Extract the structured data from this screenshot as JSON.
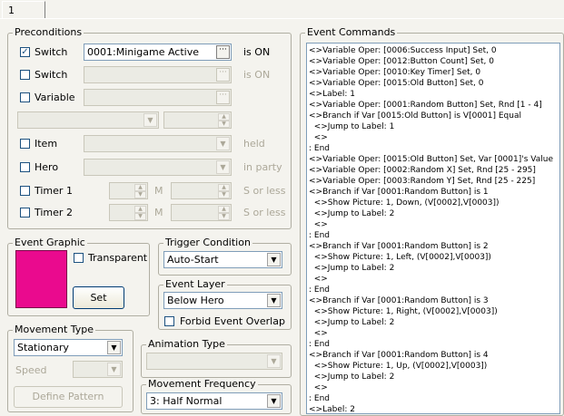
{
  "tab": {
    "label": "1"
  },
  "preconditions": {
    "title": "Preconditions",
    "switch1": {
      "label": "Switch",
      "checked": true,
      "value": "0001:Minigame Active",
      "suffix": "is ON"
    },
    "switch2": {
      "label": "Switch",
      "checked": false,
      "value": "",
      "suffix": "is ON"
    },
    "variable": {
      "label": "Variable",
      "checked": false,
      "value": ""
    },
    "item": {
      "label": "Item",
      "suffix": "held"
    },
    "hero": {
      "label": "Hero",
      "suffix": "in party"
    },
    "timer1": {
      "label": "Timer 1",
      "unit_m": "M",
      "unit_s": "S or less"
    },
    "timer2": {
      "label": "Timer 2",
      "unit_m": "M",
      "unit_s": "S or less"
    }
  },
  "event_graphic": {
    "title": "Event Graphic",
    "transparent_label": "Transparent",
    "set_label": "Set",
    "color": "#ea0a8e"
  },
  "trigger_condition": {
    "title": "Trigger Condition",
    "value": "Auto-Start"
  },
  "event_layer": {
    "title": "Event Layer",
    "value": "Below Hero",
    "forbid_label": "Forbid Event Overlap"
  },
  "movement_type": {
    "title": "Movement Type",
    "value": "Stationary",
    "speed_label": "Speed",
    "define_pattern_label": "Define Pattern"
  },
  "animation_type": {
    "title": "Animation Type",
    "value": ""
  },
  "movement_frequency": {
    "title": "Movement Frequency",
    "value": "3: Half Normal"
  },
  "event_commands": {
    "title": "Event Commands",
    "lines": [
      "<>Variable Oper: [0006:Success Input] Set, 0",
      "<>Variable Oper: [0012:Button Count] Set, 0",
      "<>Variable Oper: [0010:Key Timer] Set, 0",
      "<>Variable Oper: [0015:Old Button] Set, 0",
      "<>Label: 1",
      "<>Variable Oper: [0001:Random Button] Set, Rnd [1 - 4]",
      "<>Branch if Var [0015:Old Button] is V[0001] Equal",
      "  <>Jump to Label: 1",
      "  <>",
      ": End",
      "<>Variable Oper: [0015:Old Button] Set, Var [0001]'s Value",
      "<>Variable Oper: [0002:Random X] Set, Rnd [25 - 295]",
      "<>Variable Oper: [0003:Random Y] Set, Rnd [25 - 225]",
      "<>Branch if Var [0001:Random Button] is 1",
      "  <>Show Picture: 1, Down, (V[0002],V[0003])",
      "  <>Jump to Label: 2",
      "  <>",
      ": End",
      "<>Branch if Var [0001:Random Button] is 2",
      "  <>Show Picture: 1, Left, (V[0002],V[0003])",
      "  <>Jump to Label: 2",
      "  <>",
      ": End",
      "<>Branch if Var [0001:Random Button] is 3",
      "  <>Show Picture: 1, Right, (V[0002],V[0003])",
      "  <>Jump to Label: 2",
      "  <>",
      ": End",
      "<>Branch if Var [0001:Random Button] is 4",
      "  <>Show Picture: 1, Up, (V[0002],V[0003])",
      "  <>Jump to Label: 2",
      "  <>",
      ": End",
      "<>Label: 2"
    ]
  }
}
